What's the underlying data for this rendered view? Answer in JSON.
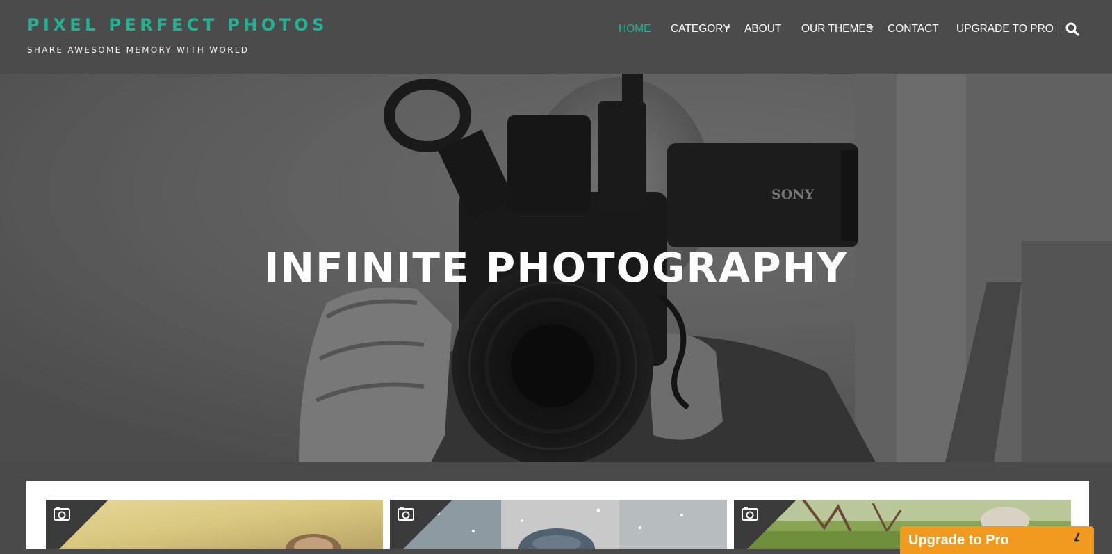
{
  "site": {
    "title": "PIXEL PERFECT PHOTOS",
    "tagline": "SHARE AWESOME MEMORY WITH WORLD"
  },
  "nav": {
    "items": [
      {
        "label": "HOME",
        "active": true,
        "dropdown": false
      },
      {
        "label": "CATEGORY",
        "active": false,
        "dropdown": true
      },
      {
        "label": "ABOUT",
        "active": false,
        "dropdown": false
      },
      {
        "label": "OUR THEMES",
        "active": false,
        "dropdown": true
      },
      {
        "label": "CONTACT",
        "active": false,
        "dropdown": false
      },
      {
        "label": "UPGRADE TO PRO",
        "active": false,
        "dropdown": false
      }
    ],
    "search_icon": "search-icon"
  },
  "hero": {
    "title": "INFINITE PHOTOGRAPHY",
    "camera_brand": "SONY"
  },
  "gallery": {
    "items": [
      {
        "icon": "camera-icon",
        "scene": "portrait-yellow"
      },
      {
        "icon": "camera-icon",
        "scene": "snow-portrait"
      },
      {
        "icon": "camera-icon",
        "scene": "outdoor-green"
      }
    ]
  },
  "upgrade": {
    "label": "Upgrade to Pro",
    "icon": "collapse-icon"
  },
  "colors": {
    "accent": "#1fb394",
    "header_bg": "#4b4b4b",
    "upgrade_bg": "#f29a1d"
  }
}
